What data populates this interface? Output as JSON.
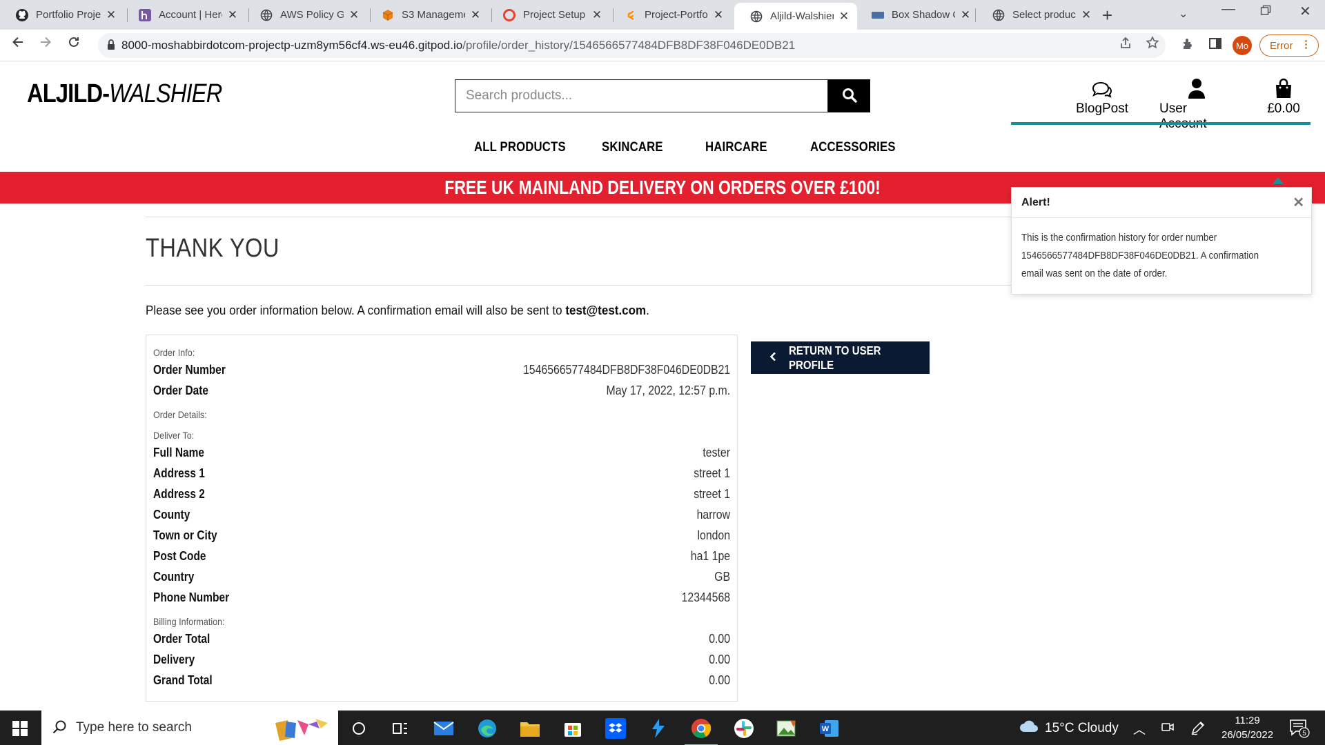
{
  "browser": {
    "tabs": [
      {
        "title": "Portfolio Proje",
        "icon": "github-icon",
        "active": false
      },
      {
        "title": "Account | Hero",
        "icon": "heroku-icon",
        "active": false
      },
      {
        "title": "AWS Policy Ge",
        "icon": "globe-icon",
        "active": false
      },
      {
        "title": "S3 Manageme",
        "icon": "aws-s3-icon",
        "active": false
      },
      {
        "title": "Project Setup",
        "icon": "opera-icon",
        "active": false
      },
      {
        "title": "Project-Portfo",
        "icon": "gitpod-icon",
        "active": false
      },
      {
        "title": "Aljild-Walshier",
        "icon": "globe-icon",
        "active": true
      },
      {
        "title": "Box Shadow C",
        "icon": "box-icon",
        "active": false
      },
      {
        "title": "Select produc",
        "icon": "globe-icon",
        "active": false
      }
    ],
    "url_host": "8000-moshabbirdotcom-projectp-uzm8ym56cf4.ws-eu46.gitpod.io",
    "url_path": "/profile/order_history/1546566577484DFB8DF38F046DE0DB21",
    "profile_initials": "Mo",
    "error_label": "Error"
  },
  "site": {
    "logo_main": "ALJILD-",
    "logo_em": "WALSHIER",
    "search_placeholder": "Search products...",
    "header_links": {
      "blog": "BlogPost",
      "account": "User Account",
      "bag": "£0.00"
    },
    "nav": [
      "ALL PRODUCTS",
      "SKINCARE",
      "HAIRCARE",
      "ACCESSORIES"
    ],
    "banner": "FREE UK MAINLAND DELIVERY ON ORDERS OVER £100!",
    "page_title": "THANK YOU",
    "intro_text": "Please see you order information below. A confirmation email will also be sent to ",
    "intro_email": "test@test.com",
    "intro_end": ".",
    "return_button": "RETURN TO USER PROFILE",
    "order": {
      "order_info_heading": "Order Info:",
      "order_number_label": "Order Number",
      "order_number": "1546566577484DFB8DF38F046DE0DB21",
      "order_date_label": "Order Date",
      "order_date": "May 17, 2022, 12:57 p.m.",
      "order_details_heading": "Order Details:",
      "deliver_to_heading": "Deliver To:",
      "delivery_fields": [
        {
          "label": "Full Name",
          "value": "tester"
        },
        {
          "label": "Address 1",
          "value": "street 1"
        },
        {
          "label": "Address 2",
          "value": "street 1"
        },
        {
          "label": "County",
          "value": "harrow"
        },
        {
          "label": "Town or City",
          "value": "london"
        },
        {
          "label": "Post Code",
          "value": "ha1 1pe"
        },
        {
          "label": "Country",
          "value": "GB"
        },
        {
          "label": "Phone Number",
          "value": "12344568"
        }
      ],
      "billing_heading": "Billing Information:",
      "billing_fields": [
        {
          "label": "Order Total",
          "value": "0.00"
        },
        {
          "label": "Delivery",
          "value": "0.00"
        },
        {
          "label": "Grand Total",
          "value": "0.00"
        }
      ]
    },
    "alert": {
      "title": "Alert!",
      "message": "This is the confirmation history for order number 1546566577484DFB8DF38F046DE0DB21. A confirmation email was sent on the date of order."
    }
  },
  "taskbar": {
    "search_placeholder": "Type here to search",
    "weather": "15°C  Cloudy",
    "time": "11:29",
    "date": "26/05/2022",
    "notification_count": "5"
  },
  "colors": {
    "banner": "#e4202f",
    "accent_teal": "#1a8f9c",
    "return_button": "#0b1a33"
  }
}
